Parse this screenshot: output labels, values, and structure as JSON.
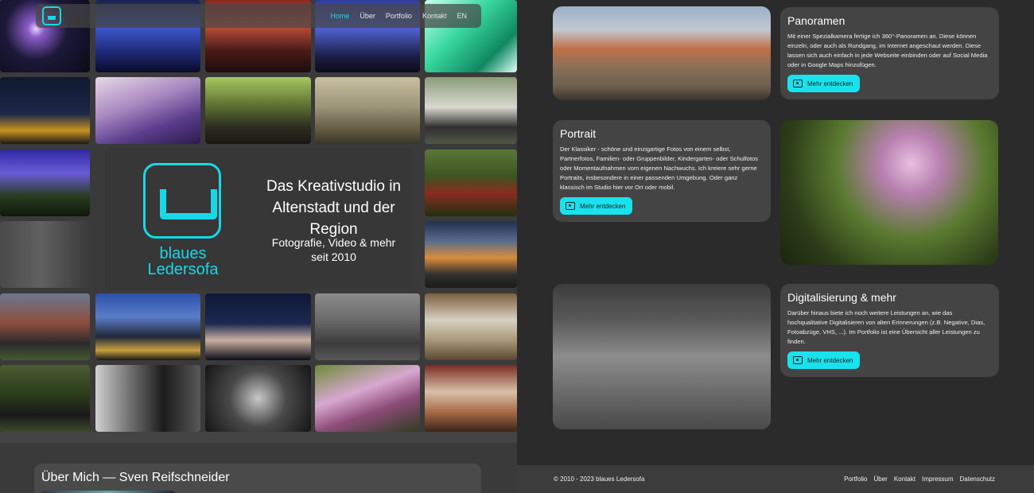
{
  "nav": {
    "logo_icon": "sofa-logo-icon",
    "links": [
      {
        "label": "Home",
        "active": true
      },
      {
        "label": "Über",
        "active": false
      },
      {
        "label": "Portfolio",
        "active": false
      },
      {
        "label": "Kontakt",
        "active": false
      },
      {
        "label": "EN",
        "active": false
      }
    ]
  },
  "hero": {
    "logo_icon": "sofa-logo-icon",
    "brand_line1": "blaues",
    "brand_line2": "Ledersofa",
    "tagline": "Das Kreativstudio in Altenstadt und der Region",
    "tagline_sub_line1": "Fotografie, Video & mehr",
    "tagline_sub_line2": "seit 2010"
  },
  "about": {
    "title": "Über Mich — Sven Reifschneider"
  },
  "services": [
    {
      "title": "Panoramen",
      "text": "Mit einer Spezialkamera fertige ich 360°-Panoramen an. Diese können einzeln, oder auch als Rundgang, im Internet angeschaut werden. Diese lassen sich auch einfach in jede Webseite einbinden oder auf Social Media oder in Google Maps hinzufügen.",
      "button": "Mehr entdecken"
    },
    {
      "title": "Portrait",
      "text": "Der Klassiker - schöne und einzigartige Fotos von einem selbst, Partnerfotos, Familien- oder Gruppenbilder, Kindergarten- oder Schulfotos oder Momentaufnahmen vom eigenen Nachwuchs. Ich kreiere sehr gerne Portraits, insbesondere in einer passenden Umgebung. Oder ganz klassisch im Studio hier vor Ort oder mobil.",
      "button": "Mehr entdecken"
    },
    {
      "title": "Digitalisierung & mehr",
      "text": "Darüber hinaus biete ich noch weitere Leistungen an, wie das hochqualitative Digitalisieren von alten Erinnerungen (z.B. Negative, Dias, Fotoabzüge, VHS, ...). Im Portfolio ist eine Übersicht aller Leistungen zu finden.",
      "button": "Mehr entdecken"
    }
  ],
  "footer": {
    "copyright": "© 2010 - 2023 blaues Ledersofa",
    "links": [
      "Portfolio",
      "Über",
      "Kontakt",
      "Impressum",
      "Datenschutz"
    ]
  },
  "colors": {
    "accent": "#18d8e8",
    "button": "#18e2ee",
    "background": "#2b2b2b",
    "card": "#444444"
  }
}
